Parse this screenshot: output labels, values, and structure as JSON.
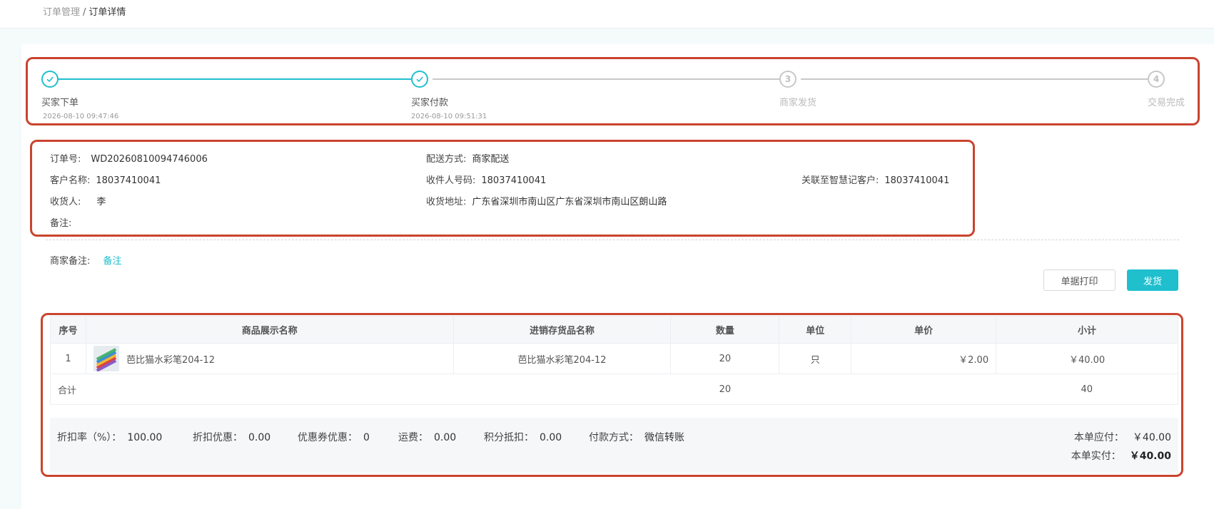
{
  "breadcrumb": {
    "parent": "订单管理",
    "separator": "/",
    "current": "订单详情"
  },
  "steps": [
    {
      "title": "买家下单",
      "time": "2026-08-10 09:47:46",
      "status": "done"
    },
    {
      "title": "买家付款",
      "time": "2026-08-10 09:51:31",
      "status": "done"
    },
    {
      "title": "商家发货",
      "number": "3",
      "status": "pending"
    },
    {
      "title": "交易完成",
      "number": "4",
      "status": "pending"
    }
  ],
  "order": {
    "order_no_label": "订单号:",
    "order_no": "WD20260810094746006",
    "delivery_label": "配送方式:",
    "delivery": "商家配送",
    "customer_label": "客户名称:",
    "customer": "18037410041",
    "receiver_phone_label": "收件人号码:",
    "receiver_phone": "18037410041",
    "linked_label": "关联至智慧记客户:",
    "linked": "18037410041",
    "receiver_label": "收货人:",
    "receiver": "李",
    "address_label": "收货地址:",
    "address": "广东省深圳市南山区广东省深圳市南山区朗山路",
    "remark_label": "备注:"
  },
  "merchant_remark": {
    "label": "商家备注:",
    "link": "备注"
  },
  "actions": {
    "print": "单据打印",
    "ship": "发货"
  },
  "table": {
    "headers": [
      "序号",
      "商品展示名称",
      "进销存货品名称",
      "数量",
      "单位",
      "单价",
      "小计"
    ],
    "rows": [
      {
        "index": "1",
        "name": "芭比猫水彩笔204-12",
        "stock_name": "芭比猫水彩笔204-12",
        "qty": "20",
        "unit": "只",
        "price": "￥2.00",
        "subtotal": "￥40.00"
      }
    ],
    "total": {
      "label": "合计",
      "qty": "20",
      "subtotal": "40"
    }
  },
  "summary": {
    "discount_rate_label": "折扣率（%）：",
    "discount_rate": "100.00",
    "discount_label": "折扣优惠：",
    "discount": "0.00",
    "coupon_label": "优惠券优惠：",
    "coupon": "0",
    "freight_label": "运费：",
    "freight": "0.00",
    "points_label": "积分抵扣：",
    "points": "0.00",
    "pay_method_label": "付款方式：",
    "pay_method": "微信转账",
    "payable_label": "本单应付：",
    "payable": "￥40.00",
    "paid_label": "本单实付：",
    "paid": "￥40.00"
  },
  "colors": {
    "accent": "#1fbfce",
    "highlight_box": "#c9442e"
  }
}
